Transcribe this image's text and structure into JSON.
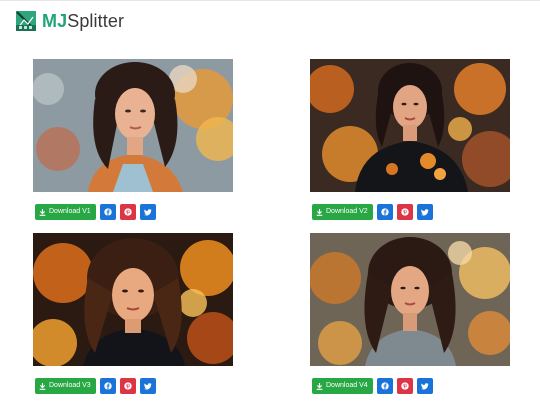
{
  "brand": {
    "prefix": "MJ",
    "suffix": "Splitter"
  },
  "cards": [
    {
      "download_label": "Download V1",
      "image": "portrait-woman-autumn-flowers"
    },
    {
      "download_label": "Download V2",
      "image": "portrait-woman-orange-floral"
    },
    {
      "download_label": "Download V3",
      "image": "portrait-woman-fiery-background"
    },
    {
      "download_label": "Download V4",
      "image": "portrait-woman-autumn-painting"
    }
  ],
  "colors": {
    "download": "#28a745",
    "facebook": "#1a73d9",
    "pinterest": "#dc3545",
    "twitter": "#1a73d9",
    "brand": "#21a47a"
  }
}
